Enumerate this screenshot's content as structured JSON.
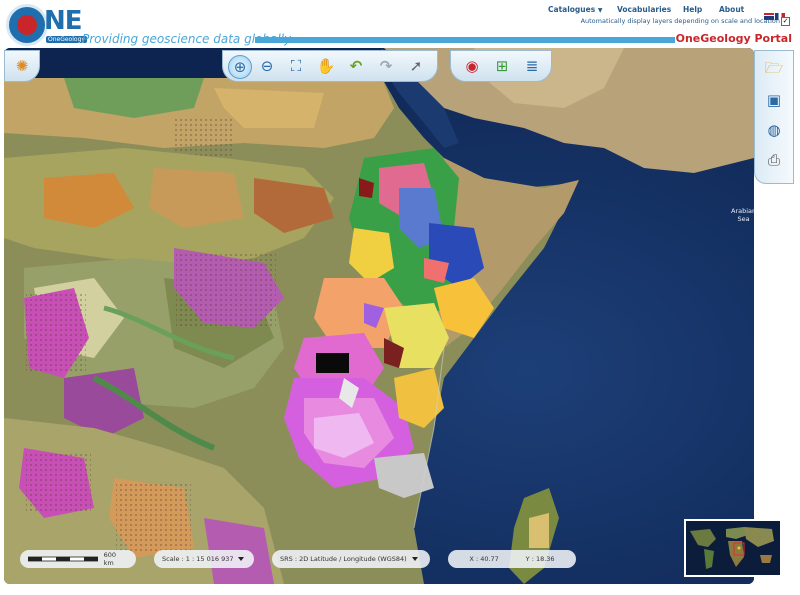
{
  "header": {
    "logo_text": "NE",
    "logo_sub": "OneGeology",
    "tagline": "Providing geoscience data globally",
    "portal_title": "OneGeology Portal"
  },
  "topnav": {
    "catalogues": "Catalogues",
    "vocabularies": "Vocabularies",
    "help": "Help",
    "about": "About"
  },
  "auto_display_label": "Automatically display layers depending on scale and location",
  "auto_display_checked": true,
  "toolbar_icons": [
    "compass-icon",
    "zoom-in-icon",
    "zoom-out-icon",
    "zoom-extent-icon",
    "pan-hand-icon",
    "undo-icon",
    "redo-icon",
    "info-pointer-icon",
    "legend-icon",
    "add-layer-icon",
    "layers-icon"
  ],
  "side_icons": [
    "folder-icon",
    "save-icon",
    "globe-icon",
    "print-icon"
  ],
  "map": {
    "sea_label": "Arabian\nSea"
  },
  "scalebar": {
    "label": "600 km"
  },
  "scale": {
    "label": "Scale : 1 : 15 016 937"
  },
  "srs": {
    "label": "SRS : 2D Latitude / Longitude (WGS84)"
  },
  "coords": {
    "x_label": "X : 40.77",
    "y_label": "Y : 18.36"
  },
  "colors": {
    "brand_blue": "#1f6fae",
    "accent_red": "#c8262b",
    "light_blue": "#4aa6d8"
  }
}
